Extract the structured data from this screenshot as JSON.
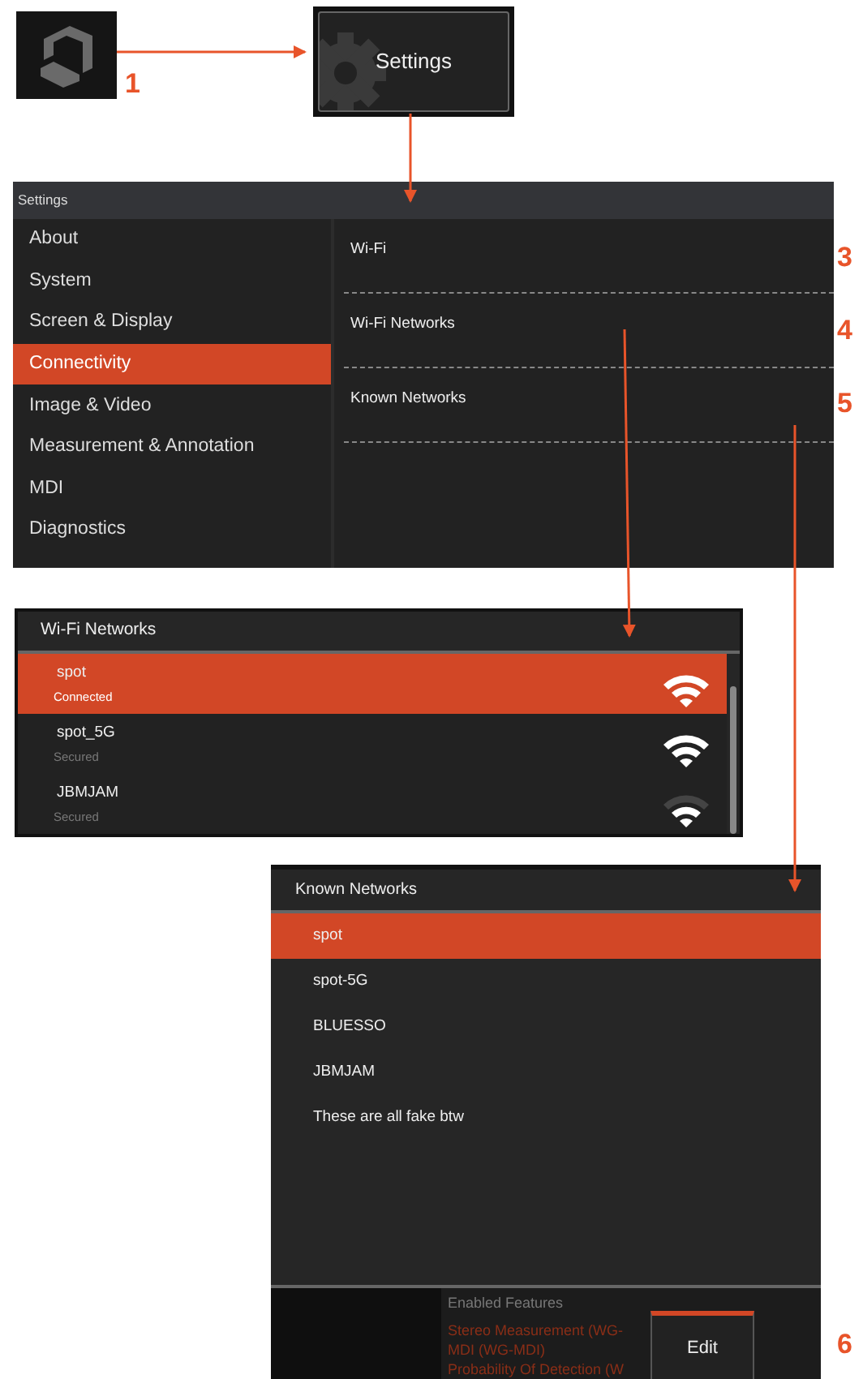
{
  "app_icon": {
    "callout": "1"
  },
  "settings_tile": {
    "label": "Settings"
  },
  "settings_window": {
    "title": "Settings",
    "sidebar": [
      {
        "label": "About",
        "selected": false
      },
      {
        "label": "System",
        "selected": false
      },
      {
        "label": "Screen & Display",
        "selected": false
      },
      {
        "label": "Connectivity",
        "selected": true
      },
      {
        "label": "Image & Video",
        "selected": false
      },
      {
        "label": "Measurement & Annotation",
        "selected": false
      },
      {
        "label": "MDI",
        "selected": false
      },
      {
        "label": "Diagnostics",
        "selected": false
      }
    ],
    "options": [
      {
        "label": "Wi-Fi",
        "callout": "3"
      },
      {
        "label": "Wi-Fi Networks",
        "callout": "4"
      },
      {
        "label": "Known Networks",
        "callout": "5"
      }
    ]
  },
  "wifi_networks": {
    "title": "Wi-Fi Networks",
    "networks": [
      {
        "name": "spot",
        "status": "Connected",
        "selected": true,
        "kind": "strong"
      },
      {
        "name": "spot_5G",
        "status": "Secured",
        "selected": false,
        "kind": "strong"
      },
      {
        "name": "JBMJAM",
        "status": "Secured",
        "selected": false,
        "kind": "weak"
      }
    ]
  },
  "known_networks": {
    "title": "Known Networks",
    "items": [
      {
        "label": "spot",
        "selected": true
      },
      {
        "label": "spot-5G",
        "selected": false
      },
      {
        "label": "BLUESSO",
        "selected": false
      },
      {
        "label": "JBMJAM",
        "selected": false
      },
      {
        "label": "These are all fake btw",
        "selected": false
      }
    ],
    "background_screen": {
      "heading": "Enabled Features",
      "features": [
        "Stereo Measurement (WG-",
        "MDI (WG-MDI)",
        "Probability Of Detection (W"
      ]
    },
    "edit_button": {
      "label": "Edit",
      "callout": "6"
    }
  }
}
